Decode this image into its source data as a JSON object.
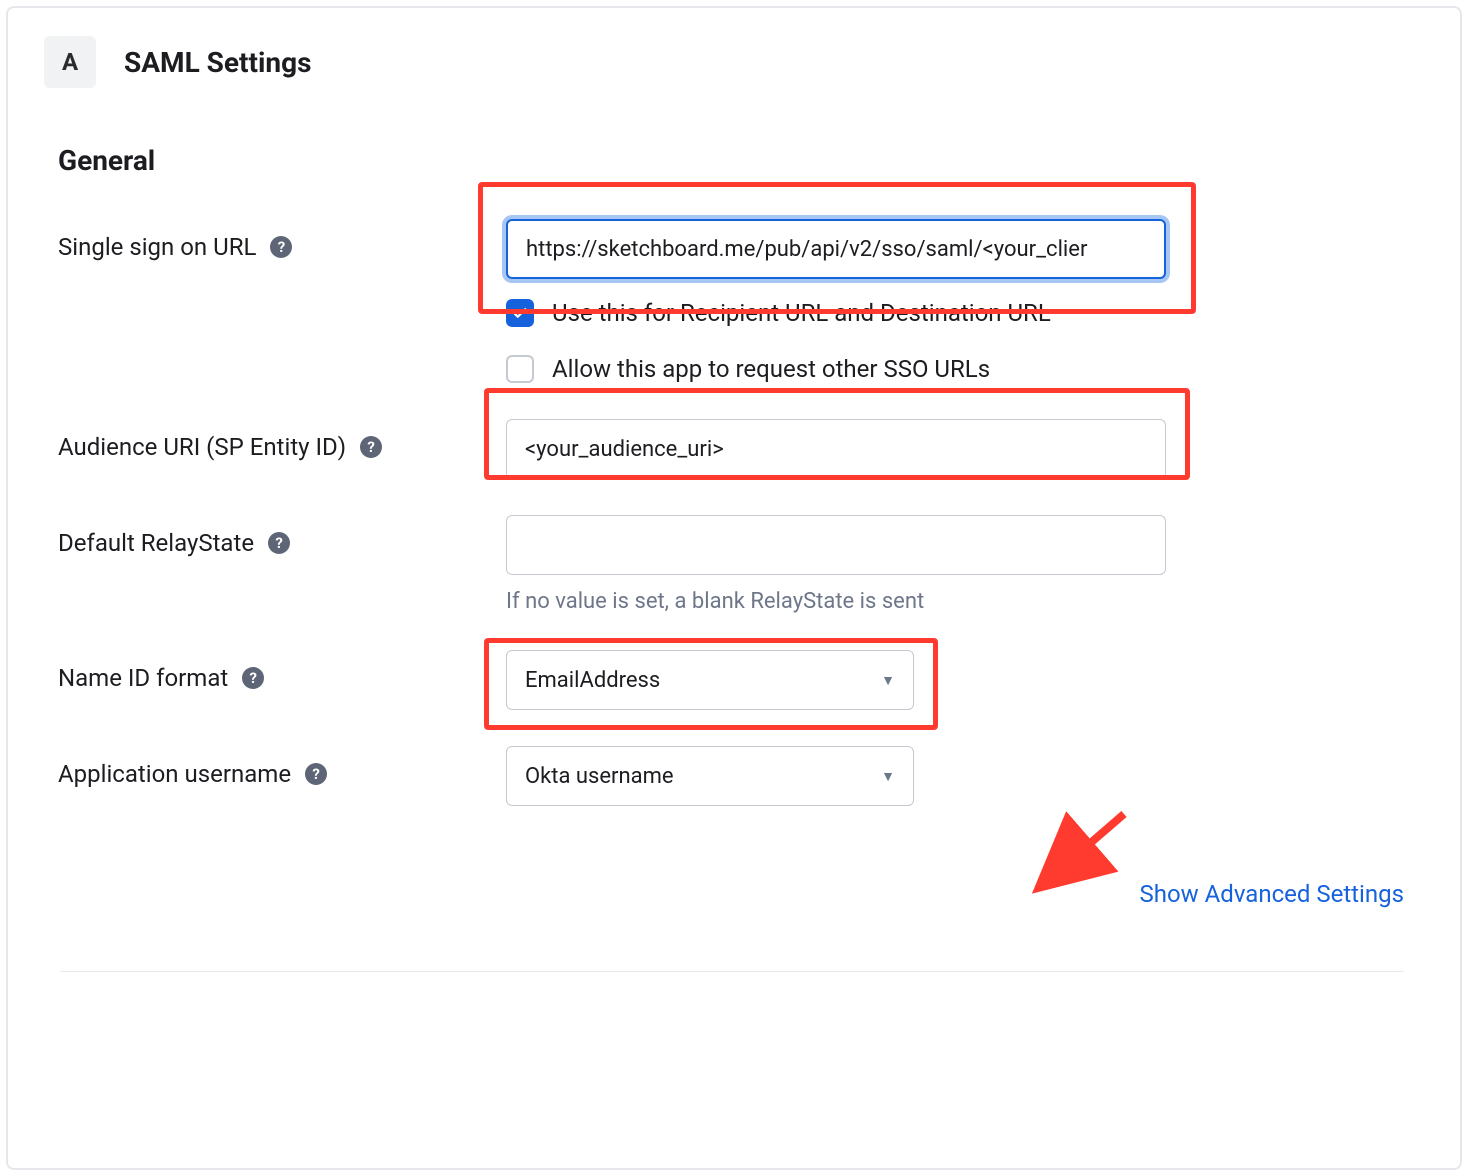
{
  "header": {
    "badge_letter": "A",
    "title": "SAML Settings"
  },
  "section": {
    "title": "General"
  },
  "fields": {
    "sso_url": {
      "label": "Single sign on URL",
      "value": "https://sketchboard.me/pub/api/v2/sso/saml/<your_clier",
      "checkbox_recipient": {
        "checked": true,
        "label": "Use this for Recipient URL and Destination URL"
      },
      "checkbox_allow_other": {
        "checked": false,
        "label": "Allow this app to request other SSO URLs"
      }
    },
    "audience_uri": {
      "label": "Audience URI (SP Entity ID)",
      "value": "<your_audience_uri>"
    },
    "default_relaystate": {
      "label": "Default RelayState",
      "value": "",
      "hint": "If no value is set, a blank RelayState is sent"
    },
    "name_id_format": {
      "label": "Name ID format",
      "value": "EmailAddress"
    },
    "app_username": {
      "label": "Application username",
      "value": "Okta username"
    }
  },
  "link": {
    "advanced": "Show Advanced Settings"
  }
}
